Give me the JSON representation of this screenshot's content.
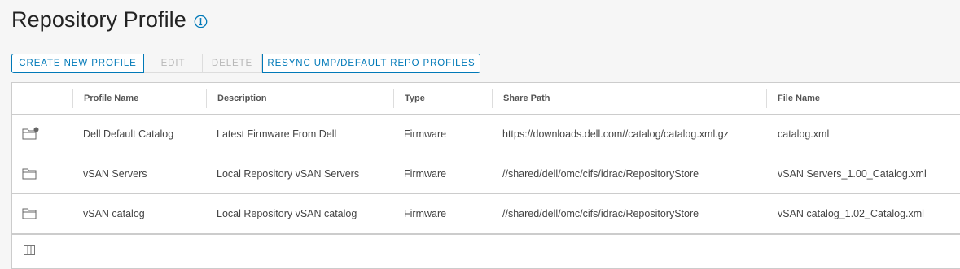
{
  "page": {
    "title": "Repository Profile",
    "info_icon": "info-circle-icon"
  },
  "toolbar": {
    "create_label": "CREATE NEW PROFILE",
    "edit_label": "EDIT",
    "delete_label": "DELETE",
    "resync_label": "RESYNC UMP/DEFAULT REPO PROFILES"
  },
  "table": {
    "columns": [
      "Profile Name",
      "Description",
      "Type",
      "Share Path",
      "File Name"
    ],
    "rows": [
      {
        "icon": "folder-sync-icon",
        "profile_name": "Dell Default Catalog",
        "description": "Latest Firmware From Dell",
        "type": "Firmware",
        "share_path": "https://downloads.dell.com//catalog/catalog.xml.gz",
        "file_name": "catalog.xml"
      },
      {
        "icon": "folder-icon",
        "profile_name": "vSAN Servers",
        "description": "Local Repository vSAN Servers",
        "type": "Firmware",
        "share_path": "//shared/dell/omc/cifs/idrac/RepositoryStore",
        "file_name": "vSAN Servers_1.00_Catalog.xml"
      },
      {
        "icon": "folder-icon",
        "profile_name": "vSAN catalog",
        "description": "Local Repository vSAN catalog",
        "type": "Firmware",
        "share_path": "//shared/dell/omc/cifs/idrac/RepositoryStore",
        "file_name": "vSAN catalog_1.02_Catalog.xml"
      }
    ],
    "footer_icon": "column-toggle-icon"
  },
  "colors": {
    "accent": "#0079b8",
    "disabled": "#b8b8b8",
    "background": "#f6f6f6",
    "border": "#cccccc"
  }
}
